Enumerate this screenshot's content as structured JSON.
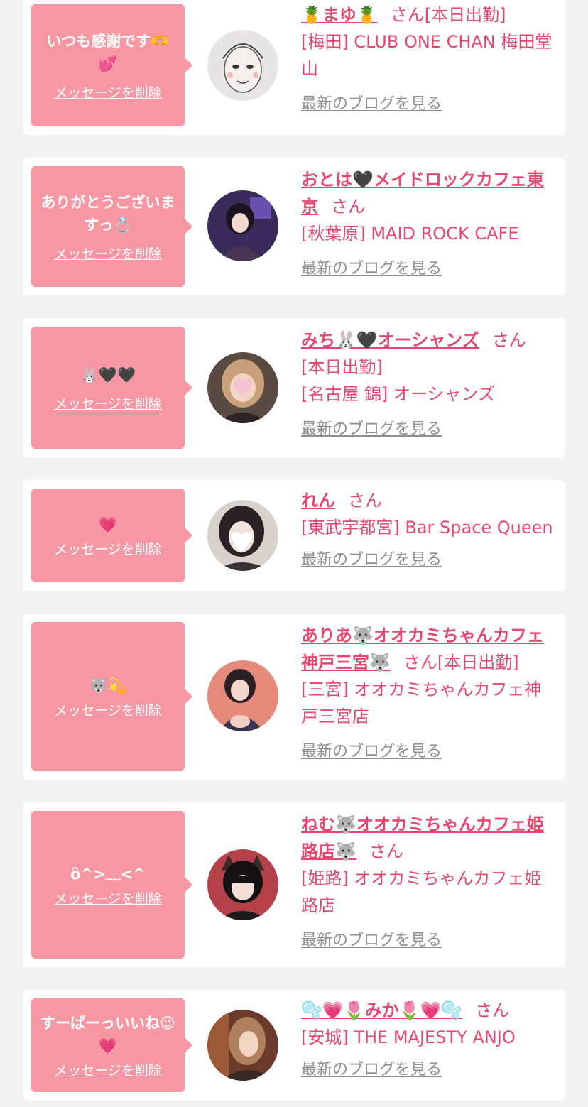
{
  "delete_label": "メッセージを削除",
  "blog_label": "最新のブログを見る",
  "honorific": "さん",
  "colors": {
    "bubble": "#f797a4",
    "accent": "#e5476f",
    "muted": "#8f8f8f",
    "background": "#f3f3f3"
  },
  "cards": [
    {
      "message": "いつも感謝です🫶💕",
      "name": "🍍まゆ🍍",
      "status": "[本日出勤]",
      "shop": "[梅田] CLUB ONE CHAN 梅田堂山"
    },
    {
      "message": "ありがとうございますっ💍",
      "name": "おとは🖤メイドロックカフェ東京",
      "status": "",
      "shop": "[秋葉原] MAID ROCK CAFE"
    },
    {
      "message": "🐰🖤🖤",
      "name": "みち🐰🖤オーシャンズ",
      "status": "[本日出勤]",
      "shop": "[名古屋 錦] オーシャンズ"
    },
    {
      "message": "💗",
      "name": "れん",
      "status": "",
      "shop": "[東武宇都宮] Bar Space Queen"
    },
    {
      "message": "🐺💫",
      "name": "ありあ🐺オオカミちゃんカフェ神戸三宮🐺",
      "status": "[本日出勤]",
      "shop": "[三宮] オオカミちゃんカフェ神戸三宮店"
    },
    {
      "message": "ὃ^>﹏<^",
      "name": "ねむ🐺オオカミちゃんカフェ姫路店🐺",
      "status": "",
      "shop": "[姫路] オオカミちゃんカフェ姫路店"
    },
    {
      "message": "すーぱーっいいね😉💗",
      "name": "🫧💗🌷みか🌷💗🫧",
      "status": "",
      "shop": "[安城] THE MAJESTY ANJO"
    }
  ]
}
